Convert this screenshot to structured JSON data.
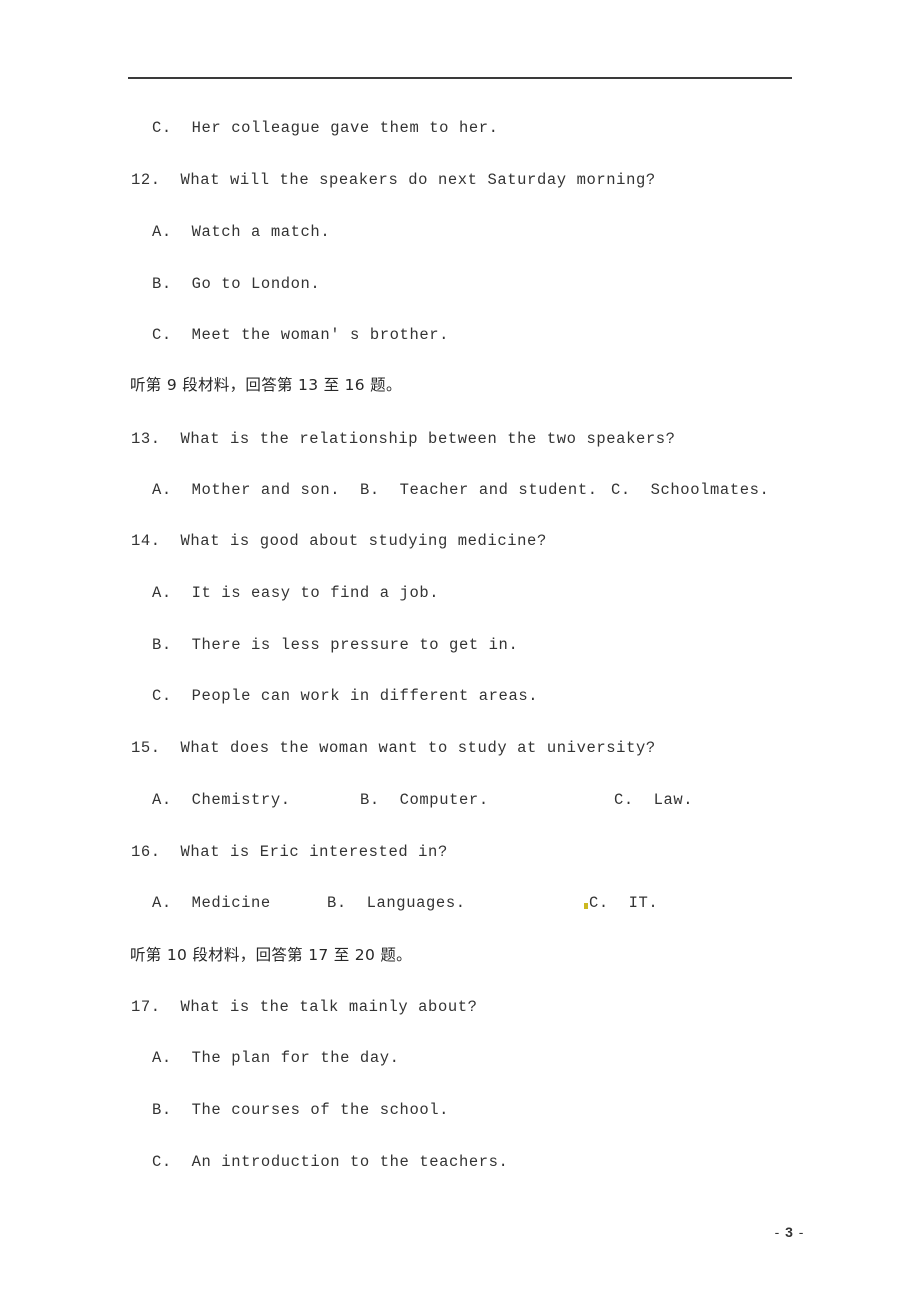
{
  "document": {
    "type": "listening-comprehension-exam",
    "page_label": "- 3 -",
    "page_number": "3",
    "page_prefix": "- ",
    "page_suffix": " -"
  },
  "content": {
    "orphan_option": "C.  Her colleague gave them to her.",
    "q12": {
      "number": "12.",
      "stem": "12.  What will the speakers do next Saturday morning?",
      "options": [
        "A.  Watch a match.",
        "B.  Go to London.",
        "C.  Meet the woman' s brother."
      ]
    },
    "instruction_9": "听第 9 段材料，回答第 13 至 16 题。",
    "q13": {
      "stem": "13.  What is the relationship between the two speakers?",
      "option_a": "A.  Mother and son.",
      "option_b": "B.  Teacher and student.",
      "option_c": "C.  Schoolmates."
    },
    "q14": {
      "stem": "14.  What is good about studying medicine?",
      "options": [
        "A.  It is easy to find a job.",
        "B.  There is less pressure to get in.",
        "C.  People can work in different areas."
      ]
    },
    "q15": {
      "stem": "15.  What does the woman want to study at university?",
      "option_a": "A.  Chemistry.",
      "option_b": "B.  Computer.",
      "option_c": "C.  Law."
    },
    "q16": {
      "stem": "16.  What is Eric interested in?",
      "option_a": "A.  Medicine",
      "option_b": "B.  Languages.",
      "option_c": "C.  IT."
    },
    "instruction_10": "听第 10 段材料，回答第 17 至 20 题。",
    "q17": {
      "stem": "17.  What is the talk mainly about?",
      "options": [
        "A.  The plan for the day.",
        "B.  The courses of the school.",
        "C.  An introduction to the teachers."
      ]
    }
  },
  "colors": {
    "page_background": "#ffffff",
    "text": "#333333",
    "rule": "#3a3a3a",
    "artifact": "#c9b415"
  }
}
